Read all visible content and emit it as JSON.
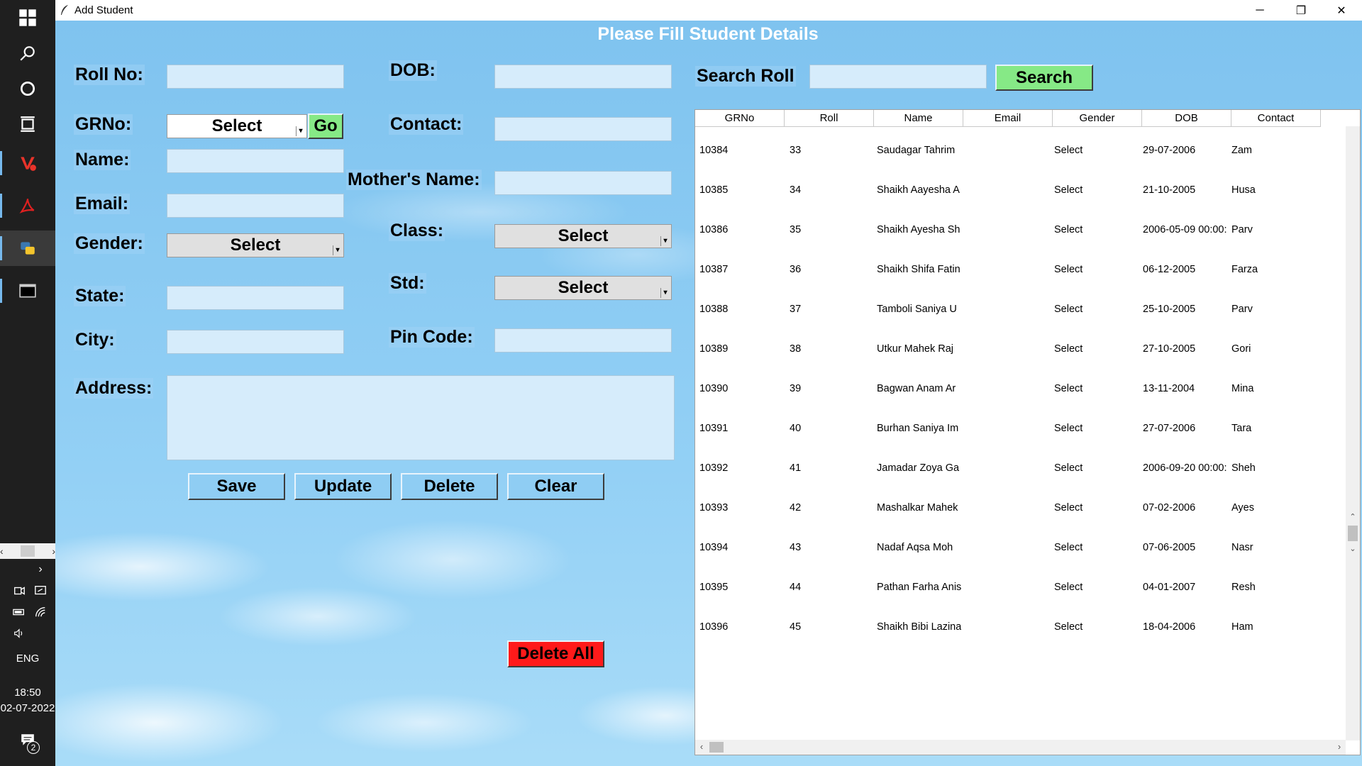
{
  "taskbar": {
    "time": "18:50",
    "date": "02-07-2022",
    "language": "ENG",
    "notification_count": "2"
  },
  "window": {
    "title": "Add Student",
    "minimize": "─",
    "restore": "❐",
    "close": "✕"
  },
  "form": {
    "heading": "Please Fill Student Details",
    "roll_label": "Roll No:",
    "grno_label": "GRNo:",
    "grno_select": "Select",
    "go_label": "Go",
    "name_label": "Name:",
    "email_label": "Email:",
    "gender_label": "Gender:",
    "gender_select": "Select",
    "state_label": "State:",
    "city_label": "City:",
    "address_label": "Address:",
    "dob_label": "DOB:",
    "contact_label": "Contact:",
    "mother_label": "Mother's Name:",
    "class_label": "Class:",
    "class_select": "Select",
    "std_label": "Std:",
    "std_select": "Select",
    "pincode_label": "Pin Code:",
    "save": "Save",
    "update": "Update",
    "delete": "Delete",
    "clear": "Clear",
    "delete_all": "Delete All"
  },
  "search": {
    "label": "Search Roll",
    "button": "Search"
  },
  "table": {
    "columns": [
      "GRNo",
      "Roll",
      "Name",
      "Email",
      "Gender",
      "DOB",
      "Contact"
    ],
    "rows": [
      [
        "10384",
        "33",
        "Saudagar Tahrim",
        "",
        "Select",
        "29-07-2006",
        "Zam"
      ],
      [
        "10385",
        "34",
        "Shaikh Aayesha A",
        "",
        "Select",
        "21-10-2005",
        "Husa"
      ],
      [
        "10386",
        "35",
        "Shaikh Ayesha Sh",
        "",
        "Select",
        "2006-05-09 00:00:",
        "Parv"
      ],
      [
        "10387",
        "36",
        "Shaikh Shifa Fatin",
        "",
        "Select",
        "06-12-2005",
        "Farza"
      ],
      [
        "10388",
        "37",
        "Tamboli Saniya U",
        "",
        "Select",
        "25-10-2005",
        "Parv"
      ],
      [
        "10389",
        "38",
        "Utkur Mahek Raj",
        "",
        "Select",
        "27-10-2005",
        "Gori"
      ],
      [
        "10390",
        "39",
        "Bagwan Anam Ar",
        "",
        "Select",
        "13-11-2004",
        "Mina"
      ],
      [
        "10391",
        "40",
        "Burhan Saniya Im",
        "",
        "Select",
        "27-07-2006",
        "Tara"
      ],
      [
        "10392",
        "41",
        "Jamadar Zoya Ga",
        "",
        "Select",
        "2006-09-20 00:00:",
        "Sheh"
      ],
      [
        "10393",
        "42",
        "Mashalkar Mahek",
        "",
        "Select",
        "07-02-2006",
        "Ayes"
      ],
      [
        "10394",
        "43",
        "Nadaf Aqsa Moh",
        "",
        "Select",
        "07-06-2005",
        "Nasr"
      ],
      [
        "10395",
        "44",
        "Pathan Farha Anis",
        "",
        "Select",
        "04-01-2007",
        "Resh"
      ],
      [
        "10396",
        "45",
        "Shaikh Bibi Lazina",
        "",
        "Select",
        "18-04-2006",
        "Ham"
      ]
    ]
  }
}
